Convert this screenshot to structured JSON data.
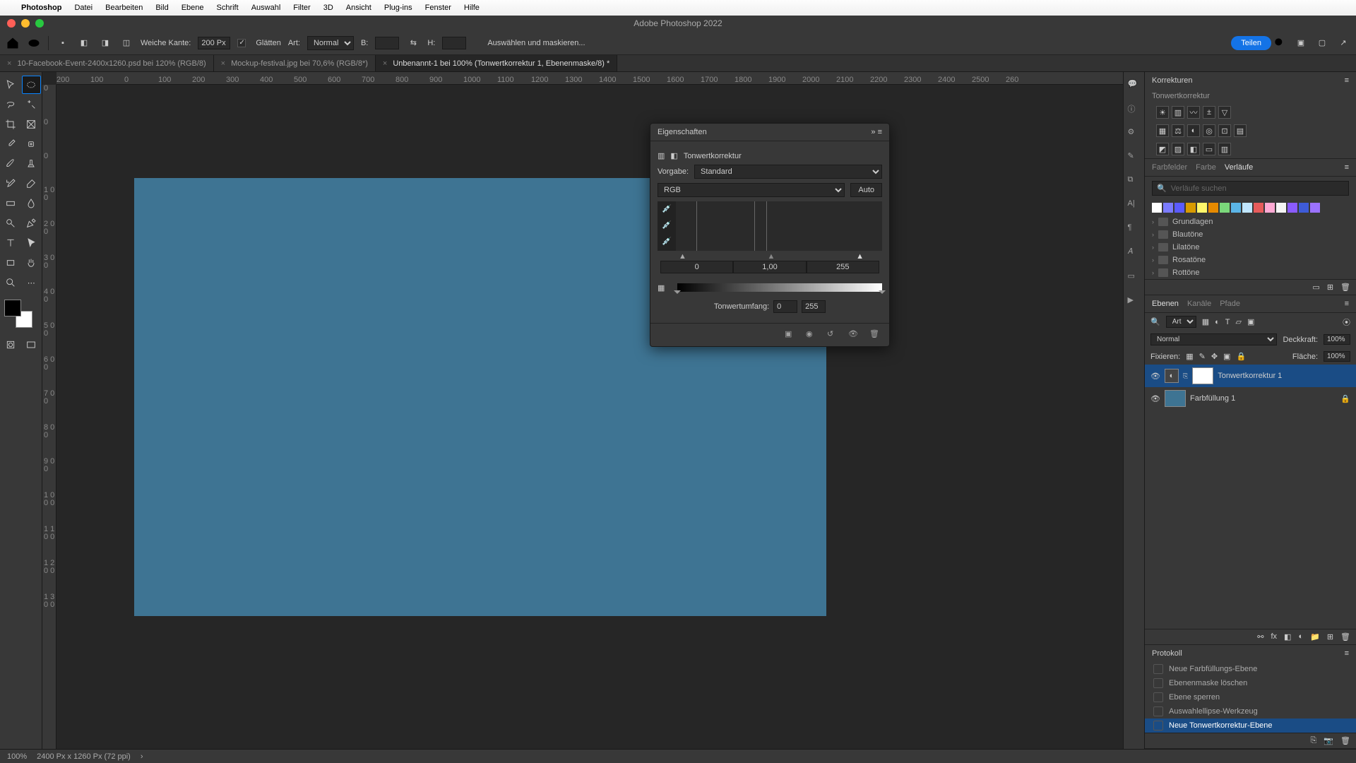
{
  "menubar": {
    "apple": "",
    "app": "Photoshop",
    "items": [
      "Datei",
      "Bearbeiten",
      "Bild",
      "Ebene",
      "Schrift",
      "Auswahl",
      "Filter",
      "3D",
      "Ansicht",
      "Plug-ins",
      "Fenster",
      "Hilfe"
    ]
  },
  "window": {
    "title": "Adobe Photoshop 2022"
  },
  "optbar": {
    "weiche_kante_label": "Weiche Kante:",
    "weiche_kante_value": "200 Px",
    "glaetten": "Glätten",
    "art_label": "Art:",
    "art_value": "Normal",
    "b_label": "B:",
    "h_label": "H:",
    "select_mask": "Auswählen und maskieren...",
    "teilen": "Teilen"
  },
  "tabs": [
    {
      "label": "10-Facebook-Event-2400x1260.psd bei 120% (RGB/8)",
      "active": false
    },
    {
      "label": "Mockup-festival.jpg bei 70,6% (RGB/8*)",
      "active": false
    },
    {
      "label": "Unbenannt-1 bei 100% (Tonwertkorrektur 1, Ebenenmaske/8) *",
      "active": true
    }
  ],
  "rulerH": [
    "200",
    "100",
    "0",
    "100",
    "200",
    "300",
    "400",
    "500",
    "600",
    "700",
    "800",
    "900",
    "1000",
    "1100",
    "1200",
    "1300",
    "1400",
    "1500",
    "1600",
    "1700",
    "1800",
    "1900",
    "2000",
    "2100",
    "2200",
    "2300",
    "2400",
    "2500",
    "260"
  ],
  "rulerV": [
    "0",
    "0",
    "0",
    "1 0 0",
    "2 0 0",
    "3 0 0",
    "4 0 0",
    "5 0 0",
    "6 0 0",
    "7 0 0",
    "8 0 0",
    "9 0 0",
    "1 0 0 0",
    "1 1 0 0",
    "1 2 0 0",
    "1 3 0 0"
  ],
  "props": {
    "title": "Eigenschaften",
    "type": "Tonwertkorrektur",
    "vorgabe_label": "Vorgabe:",
    "vorgabe_value": "Standard",
    "channel": "RGB",
    "auto": "Auto",
    "black": "0",
    "mid": "1,00",
    "white": "255",
    "output_label": "Tonwertumfang:",
    "out_lo": "0",
    "out_hi": "255"
  },
  "adjustments": {
    "title": "Korrekturen",
    "subtitle": "Tonwertkorrektur"
  },
  "gradients": {
    "tabs": [
      "Farbfelder",
      "Farbe",
      "Verläufe"
    ],
    "active_tab": 2,
    "search_placeholder": "Verläufe suchen",
    "colors": [
      "#ffffff",
      "#7b7bff",
      "#5b5bff",
      "#d89b00",
      "#fff76b",
      "#e68a00",
      "#7bd87b",
      "#5bb5e6",
      "#c0e6ff",
      "#e65b5b",
      "#ffaad4",
      "#f5f5f5",
      "#8a5bff",
      "#3e5bd8",
      "#9b72ff"
    ],
    "folders": [
      "Grundlagen",
      "Blautöne",
      "Lilatöne",
      "Rosatöne",
      "Rottöne"
    ]
  },
  "layersPanel": {
    "tabs": [
      "Ebenen",
      "Kanäle",
      "Pfade"
    ],
    "active_tab": 0,
    "filter_label": "Art",
    "blend": "Normal",
    "opacity_label": "Deckkraft:",
    "opacity": "100%",
    "lock_label": "Fixieren:",
    "fill_label": "Fläche:",
    "fill": "100%",
    "layers": [
      {
        "name": "Tonwertkorrektur 1",
        "sel": true,
        "mask": true
      },
      {
        "name": "Farbfüllung 1",
        "sel": false,
        "mask": false,
        "locked": true
      }
    ]
  },
  "history": {
    "title": "Protokoll",
    "items": [
      "Neue Farbfüllungs-Ebene",
      "Ebenenmaske löschen",
      "Ebene sperren",
      "Auswahlellipse-Werkzeug",
      "Neue Tonwertkorrektur-Ebene"
    ],
    "selected": 4
  },
  "status": {
    "zoom": "100%",
    "docinfo": "2400 Px x 1260 Px (72 ppi)"
  }
}
